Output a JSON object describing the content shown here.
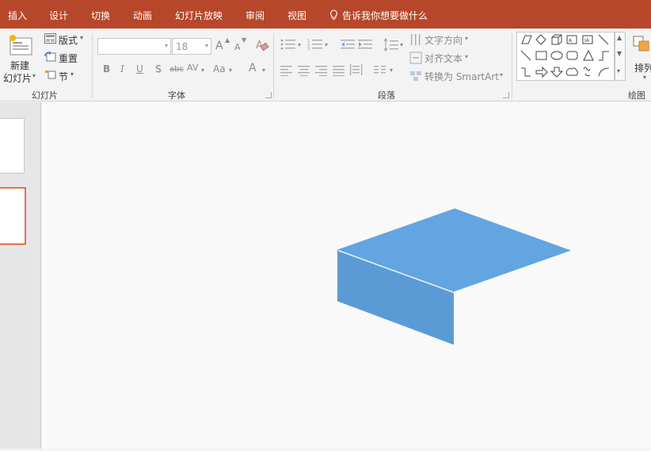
{
  "tabs": [
    {
      "label": "插入",
      "name": "tab-insert"
    },
    {
      "label": "设计",
      "name": "tab-design"
    },
    {
      "label": "切换",
      "name": "tab-transitions"
    },
    {
      "label": "动画",
      "name": "tab-animations"
    },
    {
      "label": "幻灯片放映",
      "name": "tab-slideshow"
    },
    {
      "label": "审阅",
      "name": "tab-review"
    },
    {
      "label": "视图",
      "name": "tab-view"
    }
  ],
  "tell_me": "告诉我你想要做什么",
  "slides_group": {
    "new_slide_line1": "新建",
    "new_slide_line2": "幻灯片",
    "layout": "版式",
    "reset": "重置",
    "section": "节",
    "label": "幻灯片"
  },
  "font_group": {
    "font_name": "",
    "font_size": "18",
    "grow": "A",
    "shrink": "A",
    "bold": "B",
    "italic": "I",
    "underline": "U",
    "shadow": "S",
    "strike": "abc",
    "spacing": "AV",
    "case": "Aa",
    "color": "A",
    "label": "字体"
  },
  "paragraph_group": {
    "text_direction": "文字方向",
    "align_text": "对齐文本",
    "smartart": "转换为 SmartArt",
    "label": "段落"
  },
  "drawing_group": {
    "arrange": "排列",
    "label": "绘图"
  },
  "colors": {
    "titlebar": "#b7472a",
    "shape_top": "#62a5e0",
    "shape_side": "#5b9bd5",
    "selected_thumb": "#e2714c"
  }
}
